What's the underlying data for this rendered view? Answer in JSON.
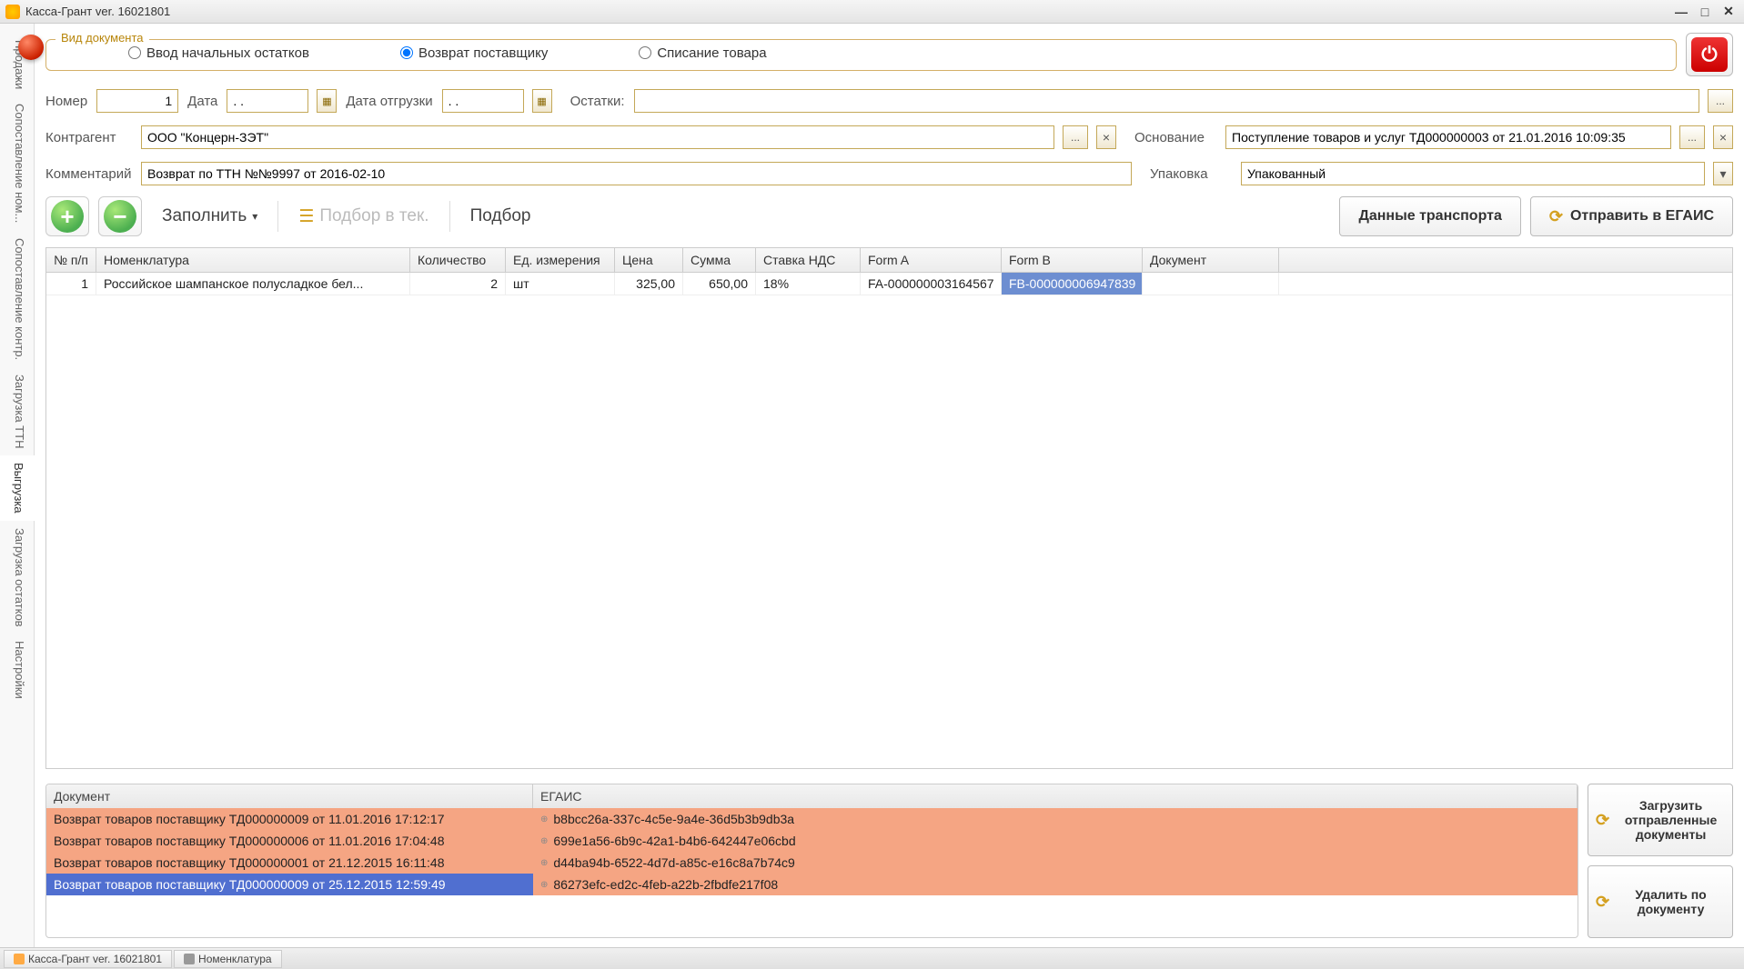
{
  "title": "Касса-Грант ver. 16021801",
  "sidebar": {
    "items": [
      {
        "label": "Продажи"
      },
      {
        "label": "Сопоставление ном..."
      },
      {
        "label": "Сопоставление контр."
      },
      {
        "label": "Загрузка ТТН"
      },
      {
        "label": "Выгрузка"
      },
      {
        "label": "Загрузка остатков"
      },
      {
        "label": "Настройки"
      }
    ],
    "active": 4
  },
  "docType": {
    "legend": "Вид документа",
    "options": [
      {
        "label": "Ввод начальных остатков"
      },
      {
        "label": "Возврат поставщику"
      },
      {
        "label": "Списание товара"
      }
    ],
    "selected": 1
  },
  "form": {
    "number_label": "Номер",
    "number_value": "1",
    "date_label": "Дата",
    "date_value": " . .",
    "ship_date_label": "Дата отгрузки",
    "ship_date_value": " . .",
    "remains_label": "Остатки:",
    "contractor_label": "Контрагент",
    "contractor_value": "ООО \"Концерн-ЗЭТ\"",
    "basis_label": "Основание",
    "basis_value": "Поступление товаров и услуг ТД000000003 от 21.01.2016 10:09:35",
    "comment_label": "Комментарий",
    "comment_value": "Возврат по ТТН №№9997 от 2016-02-10",
    "packaging_label": "Упаковка",
    "packaging_value": "Упакованный"
  },
  "toolbar": {
    "fill": "Заполнить",
    "pick_current": "Подбор в тек.",
    "pick": "Подбор",
    "transport": "Данные транспорта",
    "send_egais": "Отправить в ЕГАИС"
  },
  "grid": {
    "headers": [
      "№ п/п",
      "Номенклатура",
      "Количество",
      "Ед. измерения",
      "Цена",
      "Сумма",
      "Ставка НДС",
      "Form A",
      "Form B",
      "Документ"
    ],
    "widths": [
      55,
      345,
      105,
      120,
      75,
      80,
      115,
      155,
      155,
      150
    ],
    "rows": [
      {
        "cells": [
          "1",
          "Российское шампанское полусладкое бел...",
          "2",
          "шт",
          "325,00",
          "650,00",
          "18%",
          "FA-000000003164567",
          "FB-000000006947839",
          ""
        ],
        "selected_col": 8
      }
    ]
  },
  "docs": {
    "headers": [
      "Документ",
      "ЕГАИС"
    ],
    "col1_width": 535,
    "rows": [
      {
        "doc": "Возврат товаров поставщику ТД000000009 от 11.01.2016 17:12:17",
        "egais": "b8bcc26a-337c-4c5e-9a4e-36d5b3b9db3a"
      },
      {
        "doc": "Возврат товаров поставщику ТД000000006 от 11.01.2016 17:04:48",
        "egais": "699e1a56-6b9c-42a1-b4b6-642447e06cbd"
      },
      {
        "doc": "Возврат товаров поставщику ТД000000001 от 21.12.2015 16:11:48",
        "egais": "d44ba94b-6522-4d7d-a85c-e16c8a7b74c9"
      },
      {
        "doc": "Возврат товаров поставщику ТД000000009 от 25.12.2015 12:59:49",
        "egais": "86273efc-ed2c-4feb-a22b-2fbdfe217f08"
      }
    ],
    "selected": 3
  },
  "rightButtons": {
    "load": "Загрузить отправленные документы",
    "delete": "Удалить по документу"
  },
  "taskbar": {
    "items": [
      {
        "label": "Касса-Грант ver. 16021801"
      },
      {
        "label": "Номенклатура"
      }
    ]
  }
}
